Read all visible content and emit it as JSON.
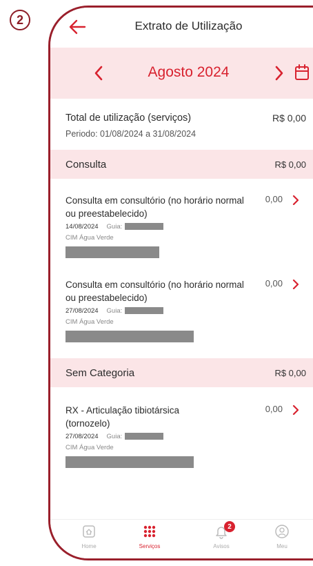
{
  "step_number": "2",
  "header": {
    "title": "Extrato de Utilização"
  },
  "month_nav": {
    "label": "Agosto 2024"
  },
  "summary": {
    "title": "Total de utilização (serviços)",
    "amount": "R$ 0,00",
    "period": "Periodo: 01/08/2024 a 31/08/2024"
  },
  "sections": [
    {
      "title": "Consulta",
      "amount": "R$ 0,00",
      "items": [
        {
          "title": "Consulta em consultório (no horário normal ou preestabelecido)",
          "value": "0,00",
          "date": "14/08/2024",
          "guia_label": "Guia:",
          "clinic": "CIM Água Verde"
        },
        {
          "title": "Consulta em consultório (no horário normal ou preestabelecido)",
          "value": "0,00",
          "date": "27/08/2024",
          "guia_label": "Guia:",
          "clinic": "CIM Água Verde"
        }
      ]
    },
    {
      "title": "Sem Categoria",
      "amount": "R$ 0,00",
      "items": [
        {
          "title": "RX - Articulação tibiotársica (tornozelo)",
          "value": "0,00",
          "date": "27/08/2024",
          "guia_label": "Guia:",
          "clinic": "CIM Água Verde"
        }
      ]
    }
  ],
  "bottom_nav": [
    {
      "label": "Home",
      "icon": "home-icon"
    },
    {
      "label": "Serviços",
      "icon": "grid-icon"
    },
    {
      "label": "Avisos",
      "icon": "bell-icon",
      "badge": "2"
    },
    {
      "label": "Meu",
      "icon": "user-icon"
    }
  ],
  "colors": {
    "brand": "#d8222f",
    "frame": "#9a1f2b",
    "band": "#fbe5e7"
  }
}
